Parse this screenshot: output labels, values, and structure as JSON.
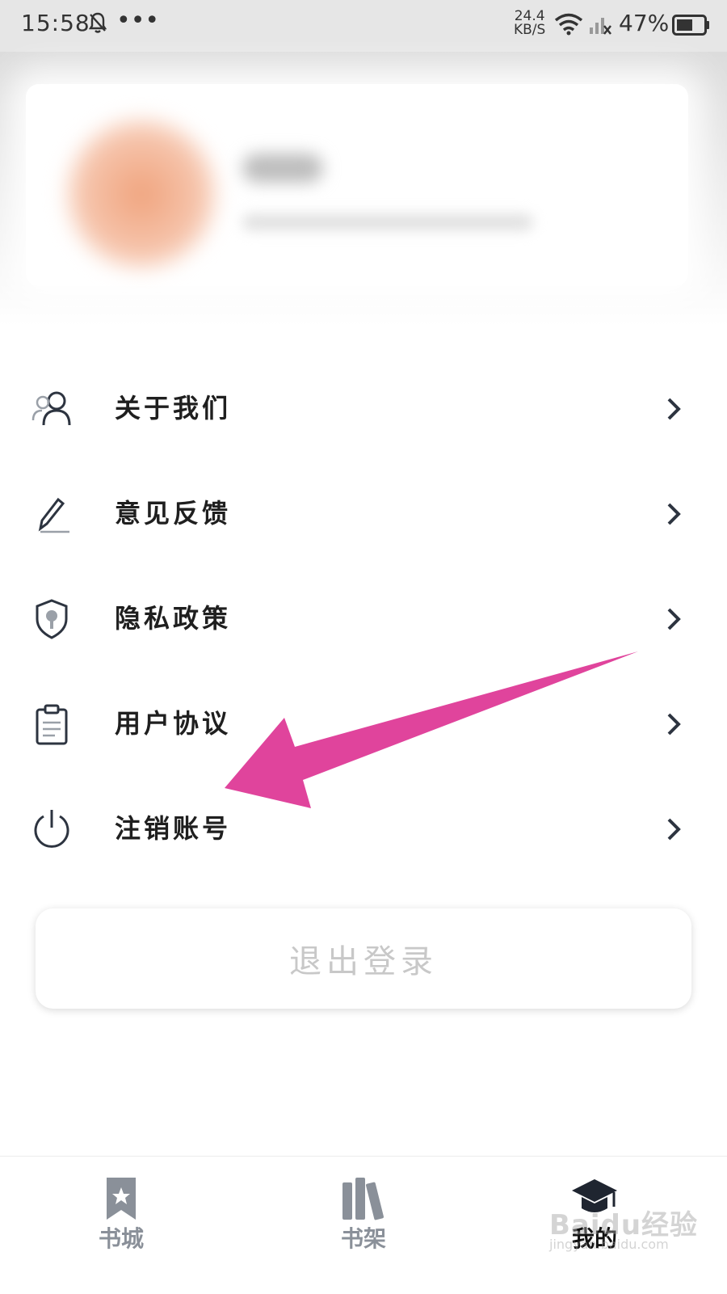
{
  "status_bar": {
    "time": "15:58",
    "speed_value": "24.4",
    "speed_unit": "KB/S",
    "battery": "47%"
  },
  "menu": {
    "items": [
      {
        "label": "关于我们",
        "icon": "user-icon"
      },
      {
        "label": "意见反馈",
        "icon": "pencil-icon"
      },
      {
        "label": "隐私政策",
        "icon": "shield-icon"
      },
      {
        "label": "用户协议",
        "icon": "clipboard-icon"
      },
      {
        "label": "注销账号",
        "icon": "power-icon"
      }
    ]
  },
  "logout_label": "退出登录",
  "bottom_nav": {
    "items": [
      {
        "label": "书城",
        "icon": "bookmark-icon"
      },
      {
        "label": "书架",
        "icon": "books-icon"
      },
      {
        "label": "我的",
        "icon": "graduation-cap-icon",
        "active": true
      }
    ]
  },
  "watermark": {
    "text": "Baidu经验",
    "sub": "jingyan.baidu.com"
  },
  "colors": {
    "arrow": "#e0449c",
    "icon": "#2d3440",
    "nav_inactive": "#8a9099"
  }
}
